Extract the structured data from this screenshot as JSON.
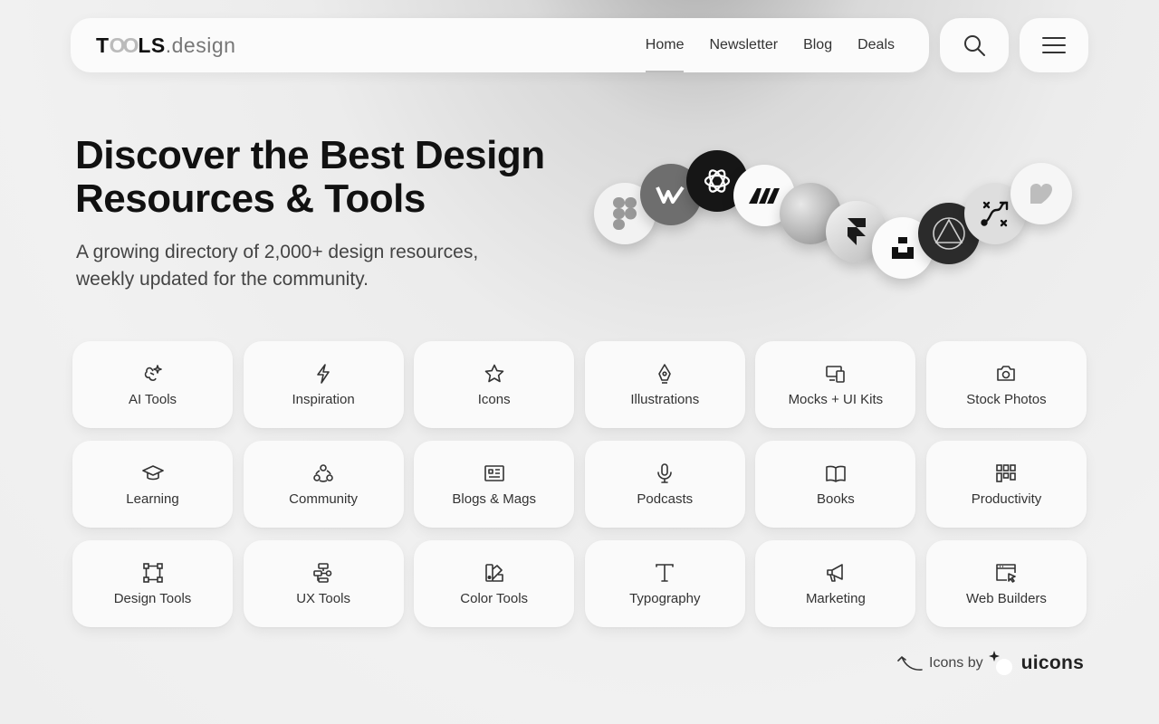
{
  "header": {
    "logo": {
      "bold_start": "T",
      "oo": "OO",
      "bold_end": "LS",
      "suffix": ".design"
    },
    "nav": [
      {
        "label": "Home",
        "active": true
      },
      {
        "label": "Newsletter"
      },
      {
        "label": "Blog"
      },
      {
        "label": "Deals"
      }
    ],
    "search_icon": "search-icon",
    "menu_icon": "hamburger-menu-icon"
  },
  "hero": {
    "title_line1": "Discover the Best Design",
    "title_line2": "Resources & Tools",
    "subtitle_line1": "A growing directory of 2,000+ design resources,",
    "subtitle_line2": "weekly updated for the community."
  },
  "tool_logos": [
    "figma",
    "webflow",
    "openai",
    "miro",
    "blob",
    "framer",
    "unsplash",
    "affinity",
    "vector-path",
    "heart"
  ],
  "categories": [
    {
      "label": "AI Tools",
      "icon": "ai-sparkle-icon"
    },
    {
      "label": "Inspiration",
      "icon": "bolt-icon"
    },
    {
      "label": "Icons",
      "icon": "star-icon"
    },
    {
      "label": "Illustrations",
      "icon": "pen-nib-icon"
    },
    {
      "label": "Mocks + UI Kits",
      "icon": "devices-icon"
    },
    {
      "label": "Stock Photos",
      "icon": "camera-icon"
    },
    {
      "label": "Learning",
      "icon": "graduation-cap-icon"
    },
    {
      "label": "Community",
      "icon": "community-icon"
    },
    {
      "label": "Blogs & Mags",
      "icon": "newspaper-icon"
    },
    {
      "label": "Podcasts",
      "icon": "microphone-icon"
    },
    {
      "label": "Books",
      "icon": "book-icon"
    },
    {
      "label": "Productivity",
      "icon": "grid-blocks-icon"
    },
    {
      "label": "Design Tools",
      "icon": "vector-frame-icon"
    },
    {
      "label": "UX Tools",
      "icon": "flowchart-icon"
    },
    {
      "label": "Color Tools",
      "icon": "swatch-icon"
    },
    {
      "label": "Typography",
      "icon": "type-icon"
    },
    {
      "label": "Marketing",
      "icon": "megaphone-icon"
    },
    {
      "label": "Web Builders",
      "icon": "browser-cursor-icon"
    }
  ],
  "credit": {
    "prefix": "Icons by",
    "brand": "uicons"
  }
}
